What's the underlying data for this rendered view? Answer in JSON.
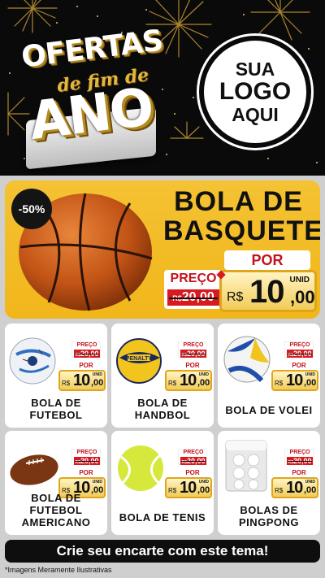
{
  "header": {
    "promo": {
      "line1": "OFERTAS",
      "line2": "de fim de",
      "line3": "ANO"
    },
    "logo": {
      "line1": "SUA",
      "line2": "LOGO",
      "line3": "AQUI"
    }
  },
  "featured": {
    "discount": "-50%",
    "title_line1": "BOLA DE",
    "title_line2": "BASQUETE",
    "preco_label": "PREÇO",
    "old_currency": "R$",
    "old_price": "20,00",
    "por_label": "POR",
    "currency": "R$",
    "price_int": "10",
    "price_cents": ",00",
    "unit": "UNID",
    "image": "basketball"
  },
  "products": [
    {
      "name_line1": "BOLA DE",
      "name_line2": "FUTEBOL",
      "image": "soccer-ball",
      "preco_label": "PREÇO",
      "old_currency": "R$",
      "old_price": "20,00",
      "por_label": "POR",
      "currency": "R$",
      "price_int": "10",
      "price_cents": ",00",
      "unit": "UNID"
    },
    {
      "name_line1": "BOLA DE",
      "name_line2": "HANDBOL",
      "image": "handball",
      "preco_label": "PREÇO",
      "old_currency": "R$",
      "old_price": "20,00",
      "por_label": "POR",
      "currency": "R$",
      "price_int": "10",
      "price_cents": ",00",
      "unit": "UNID"
    },
    {
      "name_line1": "BOLA DE VOLEI",
      "name_line2": "",
      "image": "volleyball",
      "preco_label": "PREÇO",
      "old_currency": "R$",
      "old_price": "20,00",
      "por_label": "POR",
      "currency": "R$",
      "price_int": "10",
      "price_cents": ",00",
      "unit": "UNID"
    },
    {
      "name_line1": "BOLA DE FUTEBOL",
      "name_line2": "AMERICANO",
      "image": "american-football",
      "preco_label": "PREÇO",
      "old_currency": "R$",
      "old_price": "20,00",
      "por_label": "POR",
      "currency": "R$",
      "price_int": "10",
      "price_cents": ",00",
      "unit": "UNID"
    },
    {
      "name_line1": "BOLA DE TENIS",
      "name_line2": "",
      "image": "tennis-ball",
      "preco_label": "PREÇO",
      "old_currency": "R$",
      "old_price": "20,00",
      "por_label": "POR",
      "currency": "R$",
      "price_int": "10",
      "price_cents": ",00",
      "unit": "UNID"
    },
    {
      "name_line1": "BOLAS DE",
      "name_line2": "PINGPONG",
      "image": "pingpong-balls-pack",
      "preco_label": "PREÇO",
      "old_currency": "R$",
      "old_price": "20,00",
      "por_label": "POR",
      "currency": "R$",
      "price_int": "10",
      "price_cents": ",00",
      "unit": "UNID"
    }
  ],
  "cta": "Crie seu encarte com este tema!",
  "disclaimer": "*Imagens Meramente Ilustrativas",
  "colors": {
    "accent": "#f1b61a",
    "sale_red": "#d71920",
    "header_bg": "#0a0a0a",
    "gold": "#e0a61b"
  }
}
